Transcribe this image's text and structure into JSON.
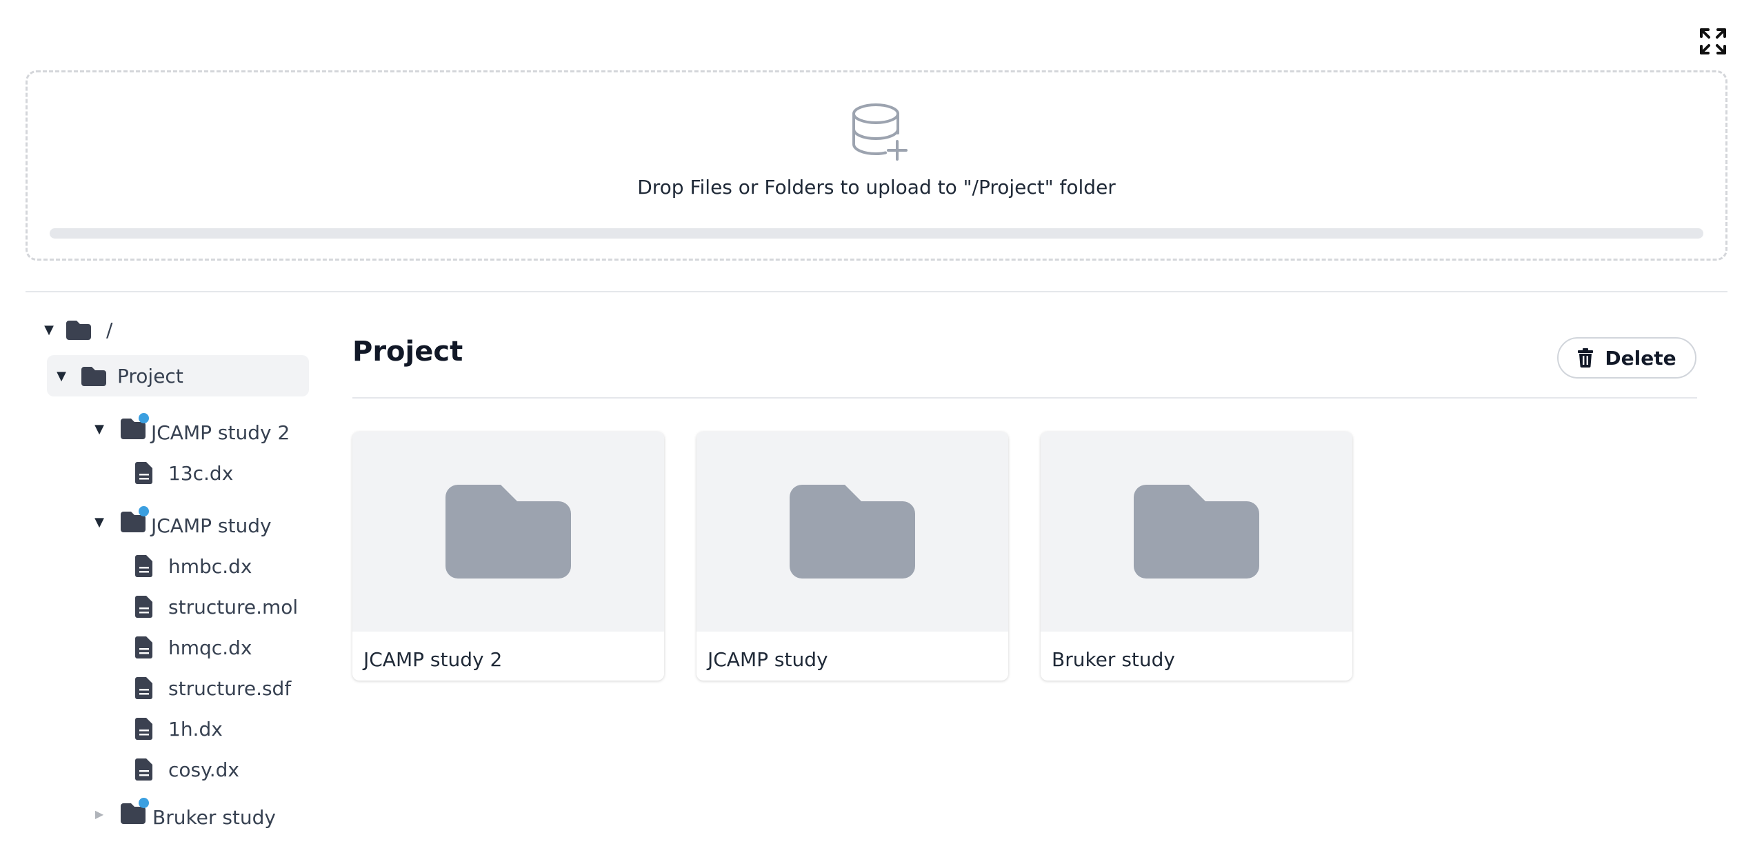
{
  "upload": {
    "text": "Drop Files or Folders to upload to \"/Project\" folder",
    "progress": 0
  },
  "tree": {
    "root_label": "/",
    "project_label": "Project",
    "folder1": {
      "label": "JCAMP study 2",
      "files": [
        "13c.dx"
      ]
    },
    "folder2": {
      "label": "JCAMP study",
      "files": [
        "hmbc.dx",
        "structure.mol",
        "hmqc.dx",
        "structure.sdf",
        "1h.dx",
        "cosy.dx"
      ]
    },
    "folder3": {
      "label": "Bruker study"
    }
  },
  "content": {
    "title": "Project",
    "delete_label": "Delete",
    "cards": [
      "JCAMP study 2",
      "JCAMP study",
      "Bruker study"
    ]
  },
  "colors": {
    "accent_dot": "#3b9fe0",
    "folder_tree": "#3b4150",
    "folder_card": "#9ca3af"
  }
}
